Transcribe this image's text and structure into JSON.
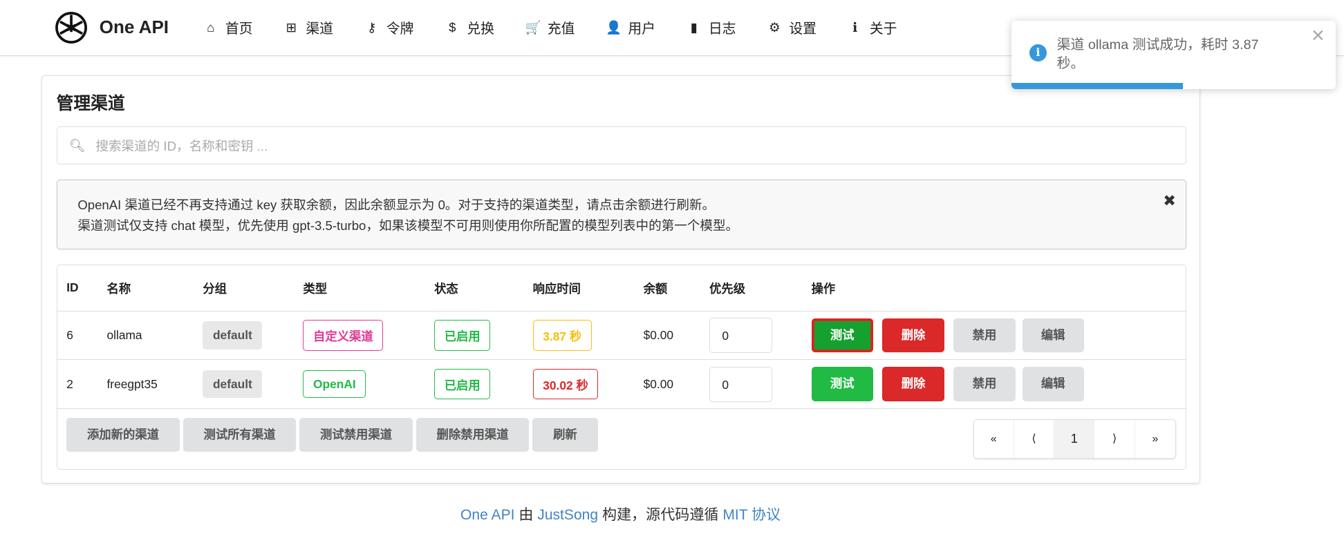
{
  "brand": "One API",
  "nav": [
    {
      "label": "首页",
      "icon": "home-icon",
      "glyph": "⌂"
    },
    {
      "label": "渠道",
      "icon": "sitemap-icon",
      "glyph": "⊞"
    },
    {
      "label": "令牌",
      "icon": "key-icon",
      "glyph": "⚷"
    },
    {
      "label": "兑换",
      "icon": "dollar-icon",
      "glyph": "$"
    },
    {
      "label": "充值",
      "icon": "cart-icon",
      "glyph": "🛒"
    },
    {
      "label": "用户",
      "icon": "user-icon",
      "glyph": "👤"
    },
    {
      "label": "日志",
      "icon": "book-icon",
      "glyph": "▮"
    },
    {
      "label": "设置",
      "icon": "gear-icon",
      "glyph": "⚙"
    },
    {
      "label": "关于",
      "icon": "info-icon",
      "glyph": "ℹ"
    }
  ],
  "page_title": "管理渠道",
  "search": {
    "placeholder": "搜索渠道的 ID，名称和密钥 ..."
  },
  "message": {
    "line1": "OpenAI 渠道已经不再支持通过 key 获取余额，因此余额显示为 0。对于支持的渠道类型，请点击余额进行刷新。",
    "line2": "渠道测试仅支持 chat 模型，优先使用 gpt-3.5-turbo，如果该模型不可用则使用你所配置的模型列表中的第一个模型。",
    "close": "✖"
  },
  "table": {
    "headers": [
      "ID",
      "名称",
      "分组",
      "类型",
      "状态",
      "响应时间",
      "余额",
      "优先级",
      "操作"
    ],
    "rows": [
      {
        "id": "6",
        "name": "ollama",
        "group": "default",
        "type": "自定义渠道",
        "type_color": "#e03997",
        "status": "已启用",
        "time": "3.87 秒",
        "time_color": "#fbbd08",
        "balance": "$0.00",
        "priority": "0"
      },
      {
        "id": "2",
        "name": "freegpt35",
        "group": "default",
        "type": "OpenAI",
        "type_color": "#21ba45",
        "status": "已启用",
        "time": "30.02 秒",
        "time_color": "#db2828",
        "balance": "$0.00",
        "priority": "0"
      }
    ],
    "actions": {
      "test": "测试",
      "delete": "删除",
      "disable": "禁用",
      "edit": "编辑"
    }
  },
  "footer_buttons": [
    "添加新的渠道",
    "测试所有渠道",
    "测试禁用渠道",
    "删除禁用渠道",
    "刷新"
  ],
  "pagination": {
    "first": "«",
    "prev": "⟨",
    "current": "1",
    "next": "⟩",
    "last": "»"
  },
  "footer": {
    "a": "One API",
    "b": " 由 ",
    "c": "JustSong",
    "d": " 构建，源代码遵循 ",
    "e": "MIT 协议"
  },
  "toast": {
    "text": "渠道 ollama 测试成功，耗时 3.87 秒。",
    "progress": 0.53,
    "close": "✕"
  }
}
